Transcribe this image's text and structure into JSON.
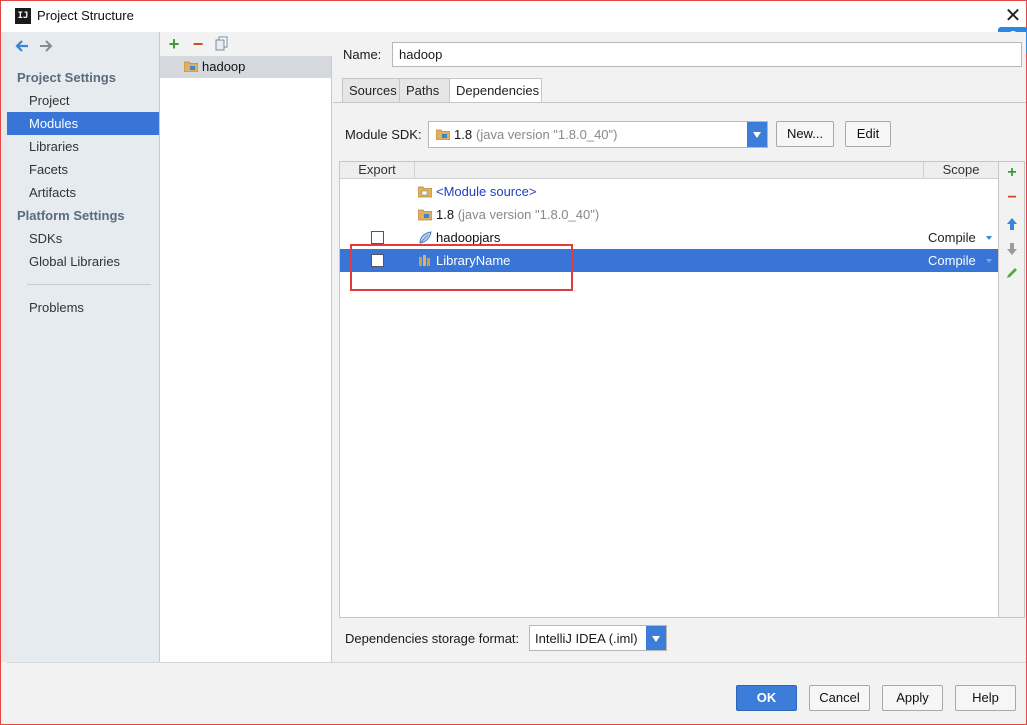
{
  "window": {
    "title": "Project Structure",
    "app_icon_text": "IJ"
  },
  "sidebar": {
    "project_settings_header": "Project Settings",
    "project_items": [
      "Project",
      "Modules",
      "Libraries",
      "Facets",
      "Artifacts"
    ],
    "platform_settings_header": "Platform Settings",
    "platform_items": [
      "SDKs",
      "Global Libraries"
    ],
    "problems": "Problems",
    "selected": "Modules"
  },
  "modules": {
    "items": [
      "hadoop"
    ],
    "selected": "hadoop"
  },
  "detail": {
    "name_label": "Name:",
    "name_value": "hadoop",
    "tabs": [
      "Sources",
      "Paths",
      "Dependencies"
    ],
    "active_tab": "Dependencies",
    "module_sdk_label": "Module SDK:",
    "sdk_version": "1.8",
    "sdk_detail": "(java version \"1.8.0_40\")",
    "new_button": "New...",
    "edit_button": "Edit",
    "table": {
      "col_export": "Export",
      "col_scope": "Scope",
      "rows": [
        {
          "name": "<Module source>",
          "detail": "",
          "scope": "",
          "checkbox": false,
          "icon": "module-source-icon"
        },
        {
          "name": "1.8",
          "detail": "(java version \"1.8.0_40\")",
          "scope": "",
          "checkbox": false,
          "icon": "sdk-folder-icon"
        },
        {
          "name": "hadoopjars",
          "detail": "",
          "scope": "Compile",
          "checkbox": true,
          "icon": "library-leaf-icon"
        },
        {
          "name": "LibraryName",
          "detail": "",
          "scope": "Compile",
          "checkbox": true,
          "icon": "library-icon",
          "selected": true
        }
      ]
    },
    "storage_label": "Dependencies storage format:",
    "storage_value": "IntelliJ IDEA (.iml)"
  },
  "footer": {
    "ok": "OK",
    "cancel": "Cancel",
    "apply": "Apply",
    "help": "Help"
  },
  "colors": {
    "selection": "#3875d7",
    "accent_blue": "#3b7dd8",
    "highlight_red": "#e03c3c"
  }
}
